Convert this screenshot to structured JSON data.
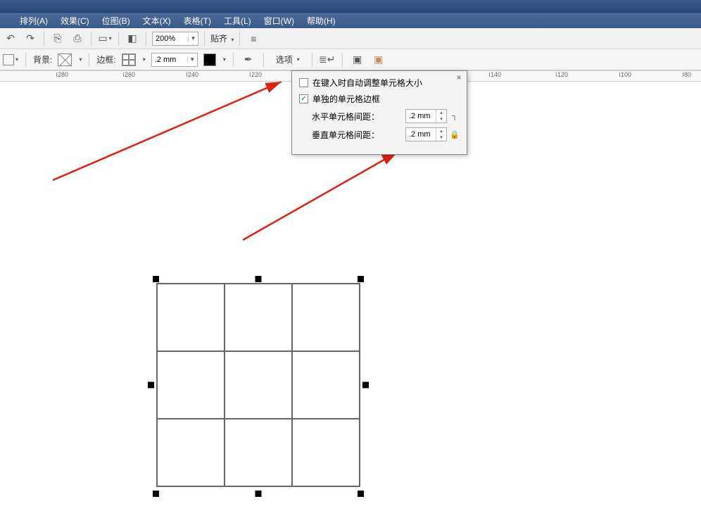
{
  "menu": {
    "arrange": "排列(A)",
    "effects": "效果(C)",
    "bitmap": "位图(B)",
    "text": "文本(X)",
    "table": "表格(T)",
    "tools": "工具(L)",
    "window": "窗口(W)",
    "help": "帮助(H)"
  },
  "toolbar1": {
    "zoom_value": "200%",
    "snap_label": "贴齐"
  },
  "toolbar2": {
    "background_label": "背景:",
    "border_label": "边框:",
    "border_width_value": ".2 mm",
    "options_label": "选项"
  },
  "ruler": {
    "ticks": [
      "280",
      "260",
      "240",
      "220",
      "",
      "",
      "140",
      "120",
      "100",
      "80"
    ]
  },
  "popout": {
    "auto_resize_label": "在键入时自动调整单元格大小",
    "auto_resize_checked": false,
    "separate_borders_label": "单独的单元格边框",
    "separate_borders_checked": true,
    "h_spacing_label": "水平单元格间距：",
    "h_spacing_value": ".2 mm",
    "v_spacing_label": "垂直单元格间距：",
    "v_spacing_value": ".2 mm"
  }
}
